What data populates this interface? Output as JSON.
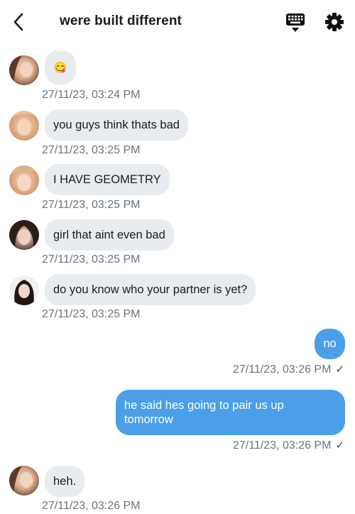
{
  "header": {
    "title": "were built different"
  },
  "messages": [
    {
      "text": "😋",
      "time": "27/11/23, 03:24 PM"
    },
    {
      "text": "you guys think thats bad",
      "time": "27/11/23, 03:25 PM"
    },
    {
      "text": "I HAVE GEOMETRY",
      "time": "27/11/23, 03:25 PM"
    },
    {
      "text": "girl that aint even bad",
      "time": "27/11/23, 03:25 PM"
    },
    {
      "text": "do you know who your partner is yet?",
      "time": "27/11/23, 03:25 PM"
    },
    {
      "text": "no",
      "time": "27/11/23, 03:26 PM",
      "status": "✓"
    },
    {
      "text": "he said hes going to pair us up tomorrow",
      "time": "27/11/23, 03:26 PM",
      "status": "✓"
    },
    {
      "text": "heh.",
      "time": "27/11/23, 03:26 PM"
    }
  ],
  "colors": {
    "outgoing_bubble": "#4a9fe8",
    "incoming_bubble": "#e8ebef",
    "timestamp": "#6b7280"
  },
  "icons": {
    "back": "chevron-left-icon",
    "keyboard": "keyboard-icon",
    "settings": "gear-icon"
  }
}
